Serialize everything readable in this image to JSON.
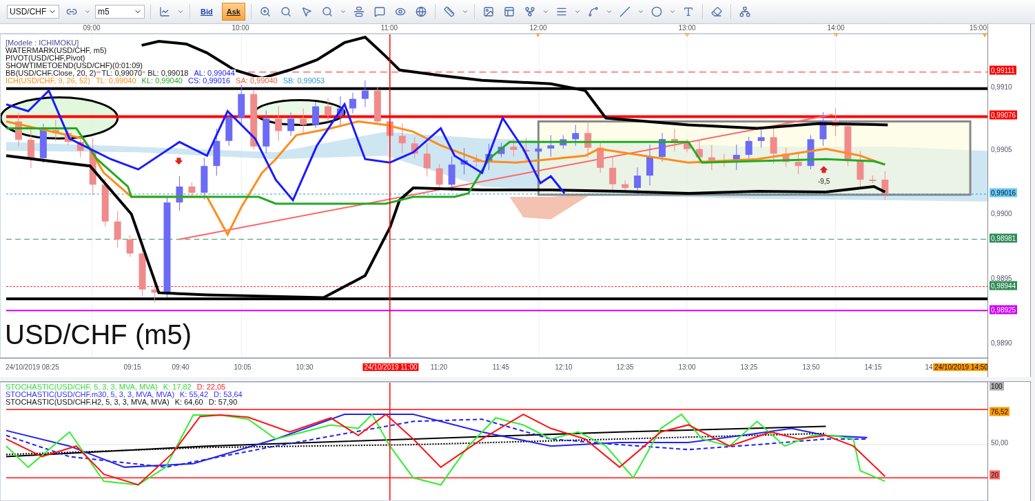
{
  "toolbar": {
    "symbol": "USD/CHF",
    "timeframe": "m5",
    "quote_buttons": [
      {
        "label": "Bid",
        "selected": false
      },
      {
        "label": "Ask",
        "selected": true
      }
    ]
  },
  "top_axis": {
    "times": [
      "09:00",
      "10:00",
      "11:00",
      "12:00",
      "13:00",
      "14:00",
      "15:00"
    ]
  },
  "legend": [
    {
      "parts": [
        {
          "text": "[Modele : ICHIMOKU]",
          "color": "#4a4a9a"
        }
      ]
    },
    {
      "parts": [
        {
          "text": "WATERMARK(USD/CHF, m5)"
        }
      ]
    },
    {
      "parts": [
        {
          "text": "PIVOT(USD/CHF,Pivot)"
        }
      ]
    },
    {
      "parts": [
        {
          "text": "SHOWTIMETOEND(USD/CHF)(0:01:09)"
        }
      ]
    },
    {
      "parts": [
        {
          "text": "BB(USD/CHF.Close, 20, 2)"
        },
        {
          "text": "TL: 0,99070"
        },
        {
          "text": "BL: 0,99018"
        },
        {
          "text": "AL: 0,99044",
          "color": "#2020ff"
        }
      ]
    },
    {
      "parts": [
        {
          "text": "ICH(USD/CHF, 9, 26, 52)",
          "color": "#ff8c1a"
        },
        {
          "text": "TL: 0,99040",
          "color": "#ff8c1a"
        },
        {
          "text": "KL: 0,99040",
          "color": "#22aa22"
        },
        {
          "text": "CS: 0,99016",
          "color": "#2020ff"
        },
        {
          "text": "SA: 0,99040",
          "color": "#e8603c"
        },
        {
          "text": "SB: 0,99053",
          "color": "#3399cc"
        }
      ]
    }
  ],
  "watermark": "USD/CHF (m5)",
  "annotation": "-9,5",
  "price_axis": {
    "ticks": [
      "0,9910",
      "0,9905",
      "0,9900",
      "0,9895",
      "0,9890"
    ],
    "tags": [
      {
        "label": "0,99111",
        "color": "#ff0000"
      },
      {
        "label": "0,99076",
        "color": "#ff0000"
      },
      {
        "label": "0,99016",
        "color": "#66ccff"
      },
      {
        "label": "0,98981",
        "color": "#2e8b57"
      },
      {
        "label": "0,98944",
        "color": "#2e8b57"
      },
      {
        "label": "0,98925",
        "color": "#cc00ff"
      }
    ]
  },
  "bottom_axis": {
    "labels": [
      {
        "kind": "time",
        "label": "24/10/2019 08:25"
      },
      {
        "kind": "time",
        "label": "09:15"
      },
      {
        "kind": "time",
        "label": "09:40"
      },
      {
        "kind": "time",
        "label": "10:05"
      },
      {
        "kind": "time",
        "label": "10:30"
      },
      {
        "kind": "tag",
        "label": "24/10/2019 11:00",
        "color": "#ff0000"
      },
      {
        "kind": "time",
        "label": "11:20"
      },
      {
        "kind": "time",
        "label": "11:45"
      },
      {
        "kind": "time",
        "label": "12:10"
      },
      {
        "kind": "time",
        "label": "12:35"
      },
      {
        "kind": "time",
        "label": "13:00"
      },
      {
        "kind": "time",
        "label": "13:25"
      },
      {
        "kind": "time",
        "label": "13:50"
      },
      {
        "kind": "time",
        "label": "14:15"
      },
      {
        "kind": "time",
        "label": "14"
      },
      {
        "kind": "tag",
        "label": "24/10/2019 14:50",
        "color": "#ff9900"
      }
    ]
  },
  "stochastic": {
    "legend": [
      {
        "parts": [
          {
            "text": "STOCHASTIC(USD/CHF, 5, 3, 3, MVA, MVA)",
            "color": "#33dd33"
          },
          {
            "text": "K: 17,82",
            "color": "#33dd33"
          },
          {
            "text": "D: 22,05",
            "color": "#ff2020"
          }
        ]
      },
      {
        "parts": [
          {
            "text": "STOCHASTIC(USD/CHF.m30, 5, 3, 3, MVA, MVA)",
            "color": "#3333ee"
          },
          {
            "text": "K: 55,42",
            "color": "#3333ee"
          },
          {
            "text": "D: 53,64",
            "color": "#3333ee"
          }
        ]
      },
      {
        "parts": [
          {
            "text": "STOCHASTIC(USD/CHF.H2, 5, 3, 3, MVA, MVA)"
          },
          {
            "text": "K: 64,60"
          },
          {
            "text": "D: 57,90"
          }
        ]
      }
    ],
    "axis": [
      {
        "kind": "tag",
        "label": "100",
        "color": "#b0b0b0"
      },
      {
        "kind": "tag",
        "label": "76,52",
        "color": "#ff9900"
      },
      {
        "kind": "tick",
        "label": "50,00"
      },
      {
        "kind": "tag",
        "label": "20",
        "color": "#ff6666"
      }
    ]
  }
}
